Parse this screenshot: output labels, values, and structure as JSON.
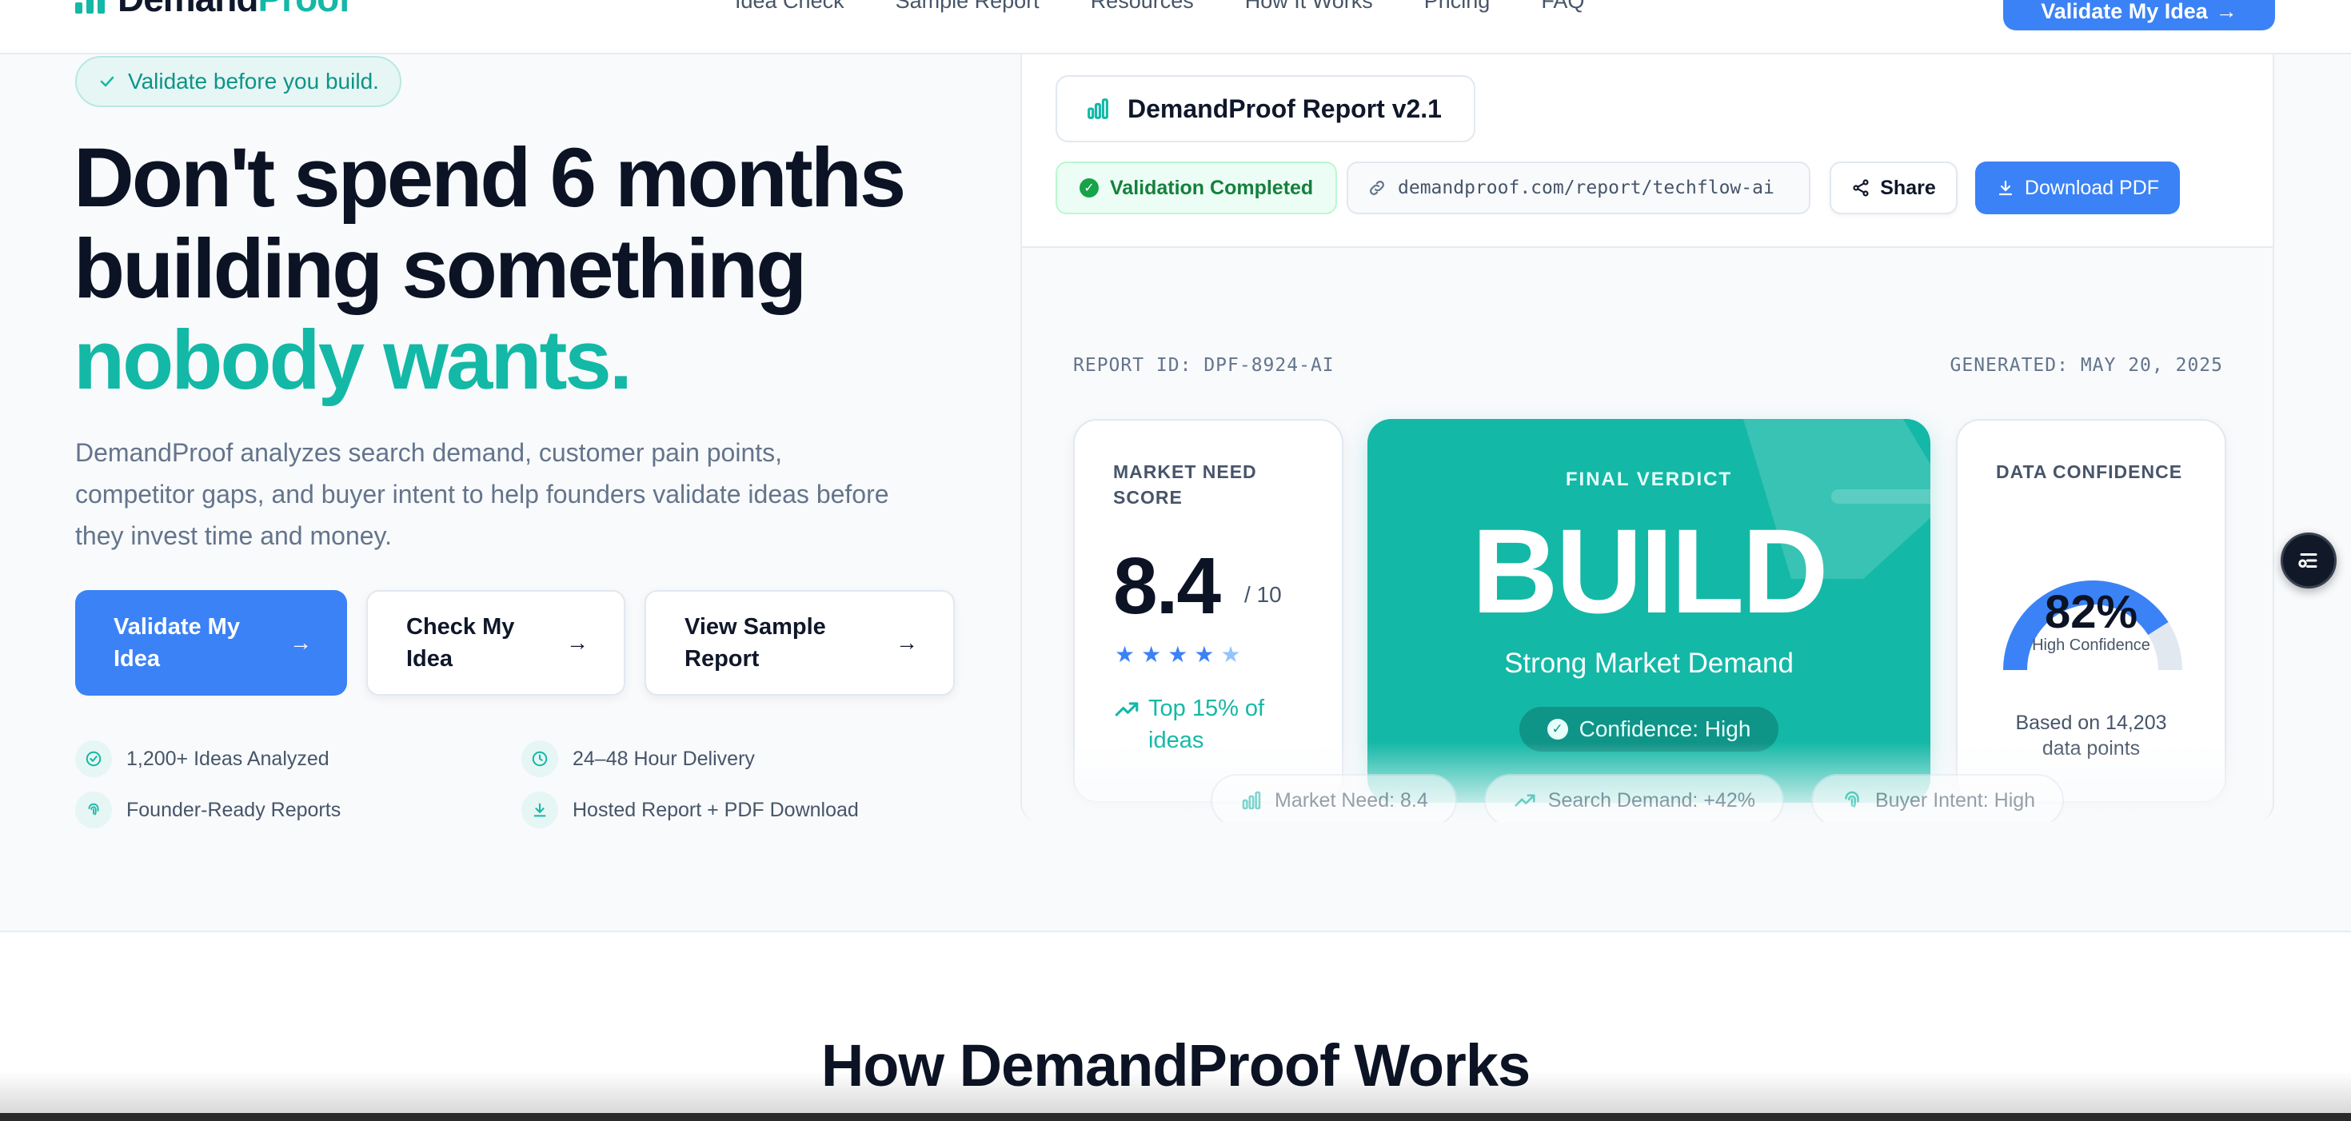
{
  "nav": {
    "logo_a": "Demand",
    "logo_b": "Proof",
    "links": [
      "Idea Check",
      "Sample Report",
      "Resources",
      "How It Works",
      "Pricing",
      "FAQ"
    ],
    "cta": "Validate My Idea",
    "cta_arrow": "→"
  },
  "hero": {
    "badge": "Validate before you build.",
    "headline_line1": "Don't spend 6 months",
    "headline_line2": "building something",
    "headline_line3": "nobody wants.",
    "subcopy": "DemandProof analyzes search demand, customer pain points, competitor gaps, and buyer intent to help founders validate ideas before they invest time and money.",
    "buttons": {
      "primary": "Validate My Idea",
      "secondary": "Check My Idea",
      "sample": "View Sample Report",
      "arrow": "→"
    },
    "features": [
      {
        "icon": "check-circle-icon",
        "label": "1,200+ Ideas Analyzed"
      },
      {
        "icon": "clock-icon",
        "label": "24–48 Hour Delivery"
      },
      {
        "icon": "fingerprint-icon",
        "label": "Founder-Ready Reports"
      },
      {
        "icon": "download-icon",
        "label": "Hosted Report + PDF Download"
      }
    ]
  },
  "report": {
    "tab_title": "DemandProof Report v2.1",
    "status": "Validation Completed",
    "url": "demandproof.com/report/techflow-ai",
    "share": "Share",
    "download": "Download PDF",
    "report_id": "REPORT ID: DPF-8924-AI",
    "generated": "GENERATED: MAY 20, 2025",
    "score_card": {
      "label": "MARKET NEED SCORE",
      "value": "8.4",
      "max": "/ 10",
      "stars": 4.5,
      "trend": "Top 15% of ideas"
    },
    "verdict": {
      "label": "FINAL VERDICT",
      "value": "BUILD",
      "sub": "Strong Market Demand",
      "pill": "Confidence: High"
    },
    "confidence": {
      "label": "DATA CONFIDENCE",
      "value": "82%",
      "percent": 82,
      "sub": "High Confidence",
      "note_line1": "Based on 14,203",
      "note_line2": "data points"
    },
    "chips": [
      {
        "icon": "bar-chart-icon",
        "label": "Market Need: 8.4"
      },
      {
        "icon": "trend-up-icon",
        "label": "Search Demand: +42%"
      },
      {
        "icon": "fingerprint-icon",
        "label": "Buyer Intent: High"
      }
    ]
  },
  "section2": {
    "title": "How DemandProof Works"
  },
  "colors": {
    "accent_blue": "#3b82f6",
    "accent_teal": "#14b8a6",
    "text_dark": "#0b1324",
    "text_muted": "#64748b"
  }
}
